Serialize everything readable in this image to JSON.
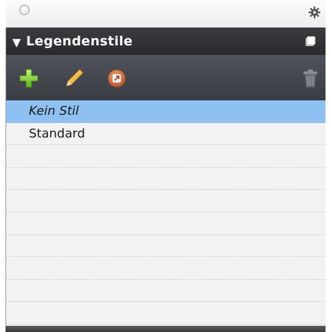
{
  "panel": {
    "title": "Legendenstile",
    "collapse_glyph": "▼"
  },
  "titlebar": {
    "close_icon": "close-circle-icon",
    "settings_icon": "gear-icon"
  },
  "header": {
    "menu_icon": "panel-menu-icon"
  },
  "toolbar": {
    "items": [
      {
        "name": "add-style-button",
        "icon": "plus-icon",
        "color": "#8fd83b"
      },
      {
        "name": "edit-style-button",
        "icon": "pencil-icon",
        "color": "#f0c94a"
      },
      {
        "name": "apply-style-button",
        "icon": "link-arrow-icon",
        "color": "#d07a55"
      },
      {
        "name": "delete-style-button",
        "icon": "trash-icon",
        "color": "#7a7c84"
      }
    ]
  },
  "styles": {
    "items": [
      {
        "label": "Kein Stil",
        "selected": true
      },
      {
        "label": "Standard",
        "selected": false
      }
    ],
    "selection_color": "#8ec0f2"
  }
}
